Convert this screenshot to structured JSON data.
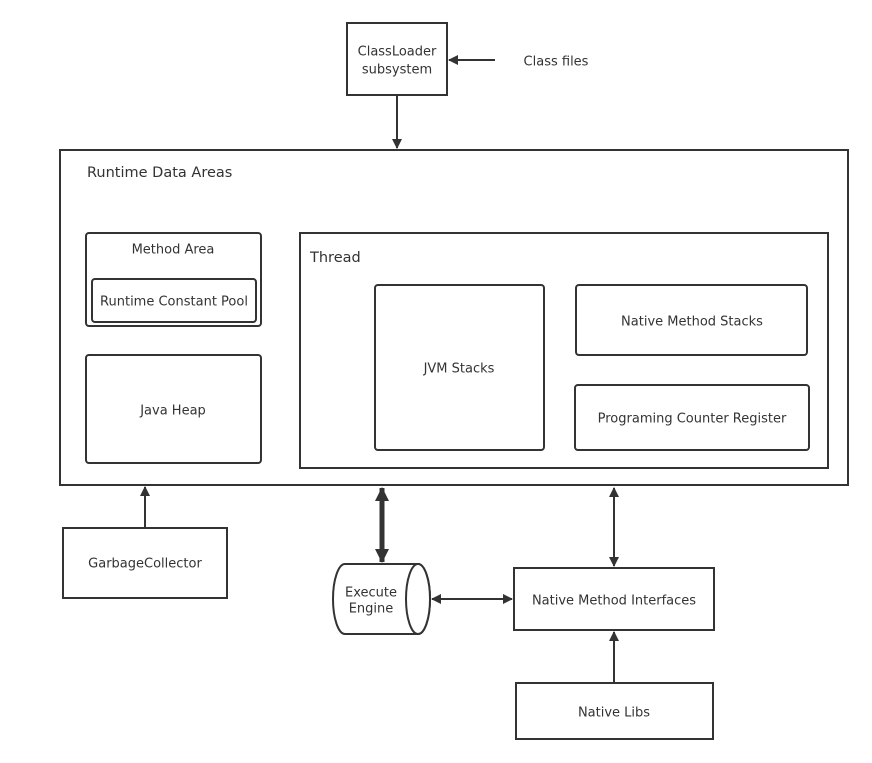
{
  "nodes": {
    "classloader": [
      "ClassLoader",
      "subsystem"
    ],
    "class_files": "Class files",
    "runtime_data_areas": "Runtime Data Areas",
    "method_area": "Method Area",
    "runtime_constant_pool": "Runtime Constant Pool",
    "java_heap": "Java Heap",
    "thread": "Thread",
    "jvm_stacks": "JVM Stacks",
    "native_method_stacks": "Native Method Stacks",
    "pc_register": "Programing Counter Register",
    "garbage_collector": "GarbageCollector",
    "execute_engine": [
      "Execute",
      "Engine"
    ],
    "native_method_interfaces": "Native Method Interfaces",
    "native_libs": "Native Libs"
  }
}
